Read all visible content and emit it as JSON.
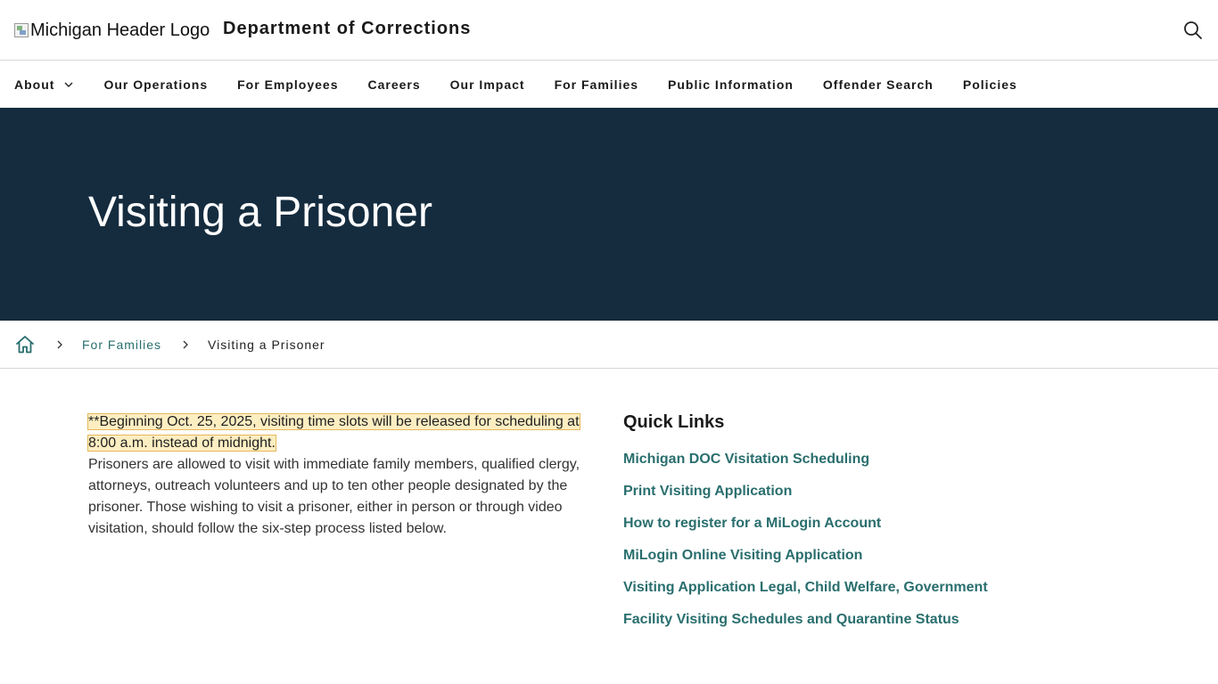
{
  "header": {
    "logo_alt": "Michigan Header Logo",
    "site_title": "Department of Corrections",
    "search_icon": "search-icon"
  },
  "nav": {
    "items": [
      {
        "label": "About",
        "has_dropdown": true
      },
      {
        "label": "Our Operations"
      },
      {
        "label": "For Employees"
      },
      {
        "label": "Careers"
      },
      {
        "label": "Our Impact"
      },
      {
        "label": "For Families"
      },
      {
        "label": "Public Information"
      },
      {
        "label": "Offender Search"
      },
      {
        "label": "Policies"
      }
    ]
  },
  "hero": {
    "title": "Visiting a Prisoner",
    "background_color": "#152c3e"
  },
  "breadcrumb": {
    "home_icon": "home-icon",
    "parent": "For Families",
    "current": "Visiting a Prisoner"
  },
  "main": {
    "notice": "**Beginning Oct. 25, 2025, visiting time slots will be released for scheduling at 8:00 a.m. instead of midnight.",
    "body": "Prisoners are allowed to visit with immediate family members, qualified clergy, attorneys, outreach volunteers and up to ten other people designated by the prisoner. Those wishing to visit a prisoner, either in person or through video visitation, should follow the six-step process listed below."
  },
  "quick_links": {
    "heading": "Quick Links",
    "links": [
      "Michigan DOC Visitation Scheduling",
      "Print Visiting Application",
      "How to register for a MiLogin Account",
      "MiLogin Online Visiting Application",
      "Visiting Application Legal, Child Welfare, Government",
      "Facility Visiting Schedules and Quarantine Status"
    ]
  },
  "colors": {
    "link": "#2a6e6e",
    "notice_highlight": "#fdeec2"
  }
}
